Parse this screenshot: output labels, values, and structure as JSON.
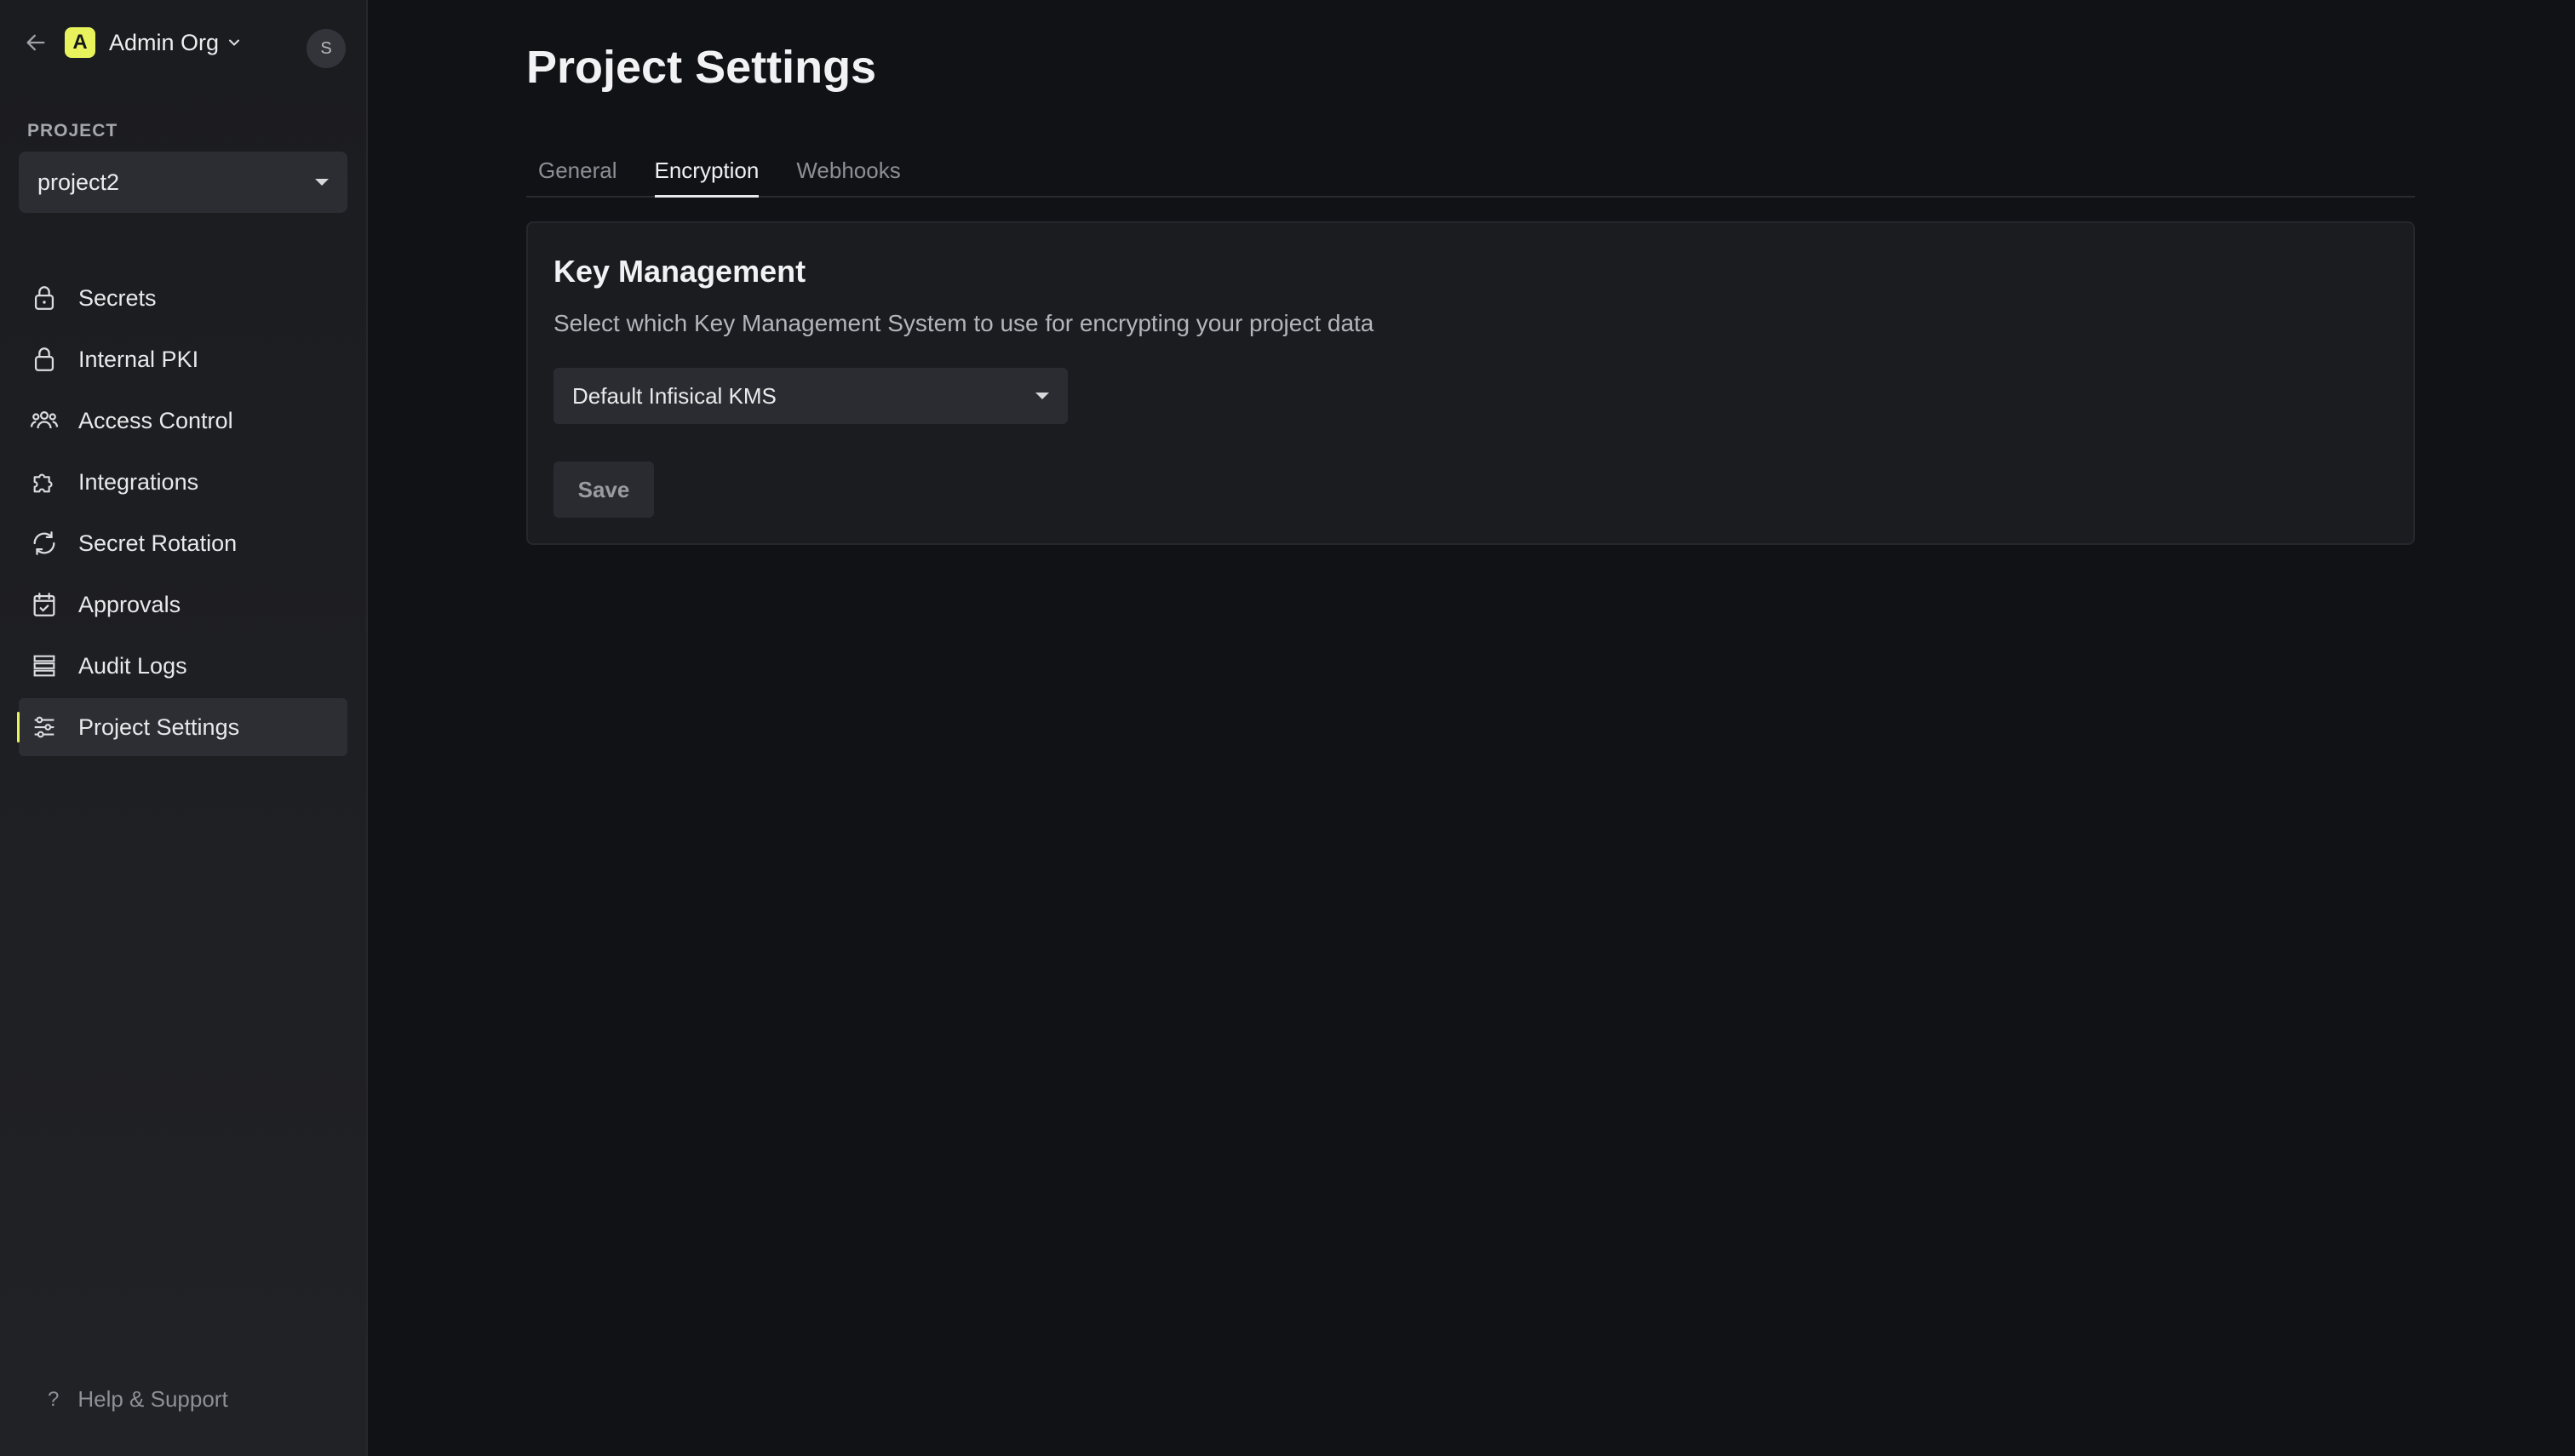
{
  "sidebar": {
    "org_name": "Admin Org",
    "org_logo_letter": "A",
    "avatar_letter": "S",
    "project_label": "PROJECT",
    "project_value": "project2",
    "items": [
      {
        "label": "Secrets",
        "icon": "lock-icon"
      },
      {
        "label": "Internal PKI",
        "icon": "lock-icon"
      },
      {
        "label": "Access Control",
        "icon": "users-icon"
      },
      {
        "label": "Integrations",
        "icon": "puzzle-icon"
      },
      {
        "label": "Secret Rotation",
        "icon": "rotate-icon"
      },
      {
        "label": "Approvals",
        "icon": "calendar-check-icon"
      },
      {
        "label": "Audit Logs",
        "icon": "list-icon"
      },
      {
        "label": "Project Settings",
        "icon": "sliders-icon",
        "active": true
      }
    ],
    "help_label": "Help & Support"
  },
  "main": {
    "title": "Project Settings",
    "tabs": [
      {
        "label": "General"
      },
      {
        "label": "Encryption",
        "active": true
      },
      {
        "label": "Webhooks"
      }
    ],
    "card": {
      "title": "Key Management",
      "description": "Select which Key Management System to use for encrypting your project data",
      "kms_value": "Default Infisical KMS",
      "save_label": "Save"
    }
  },
  "colors": {
    "accent": "#e8f25c",
    "background": "#111216",
    "sidebar": "#1b1c20",
    "card": "#1b1c20"
  }
}
